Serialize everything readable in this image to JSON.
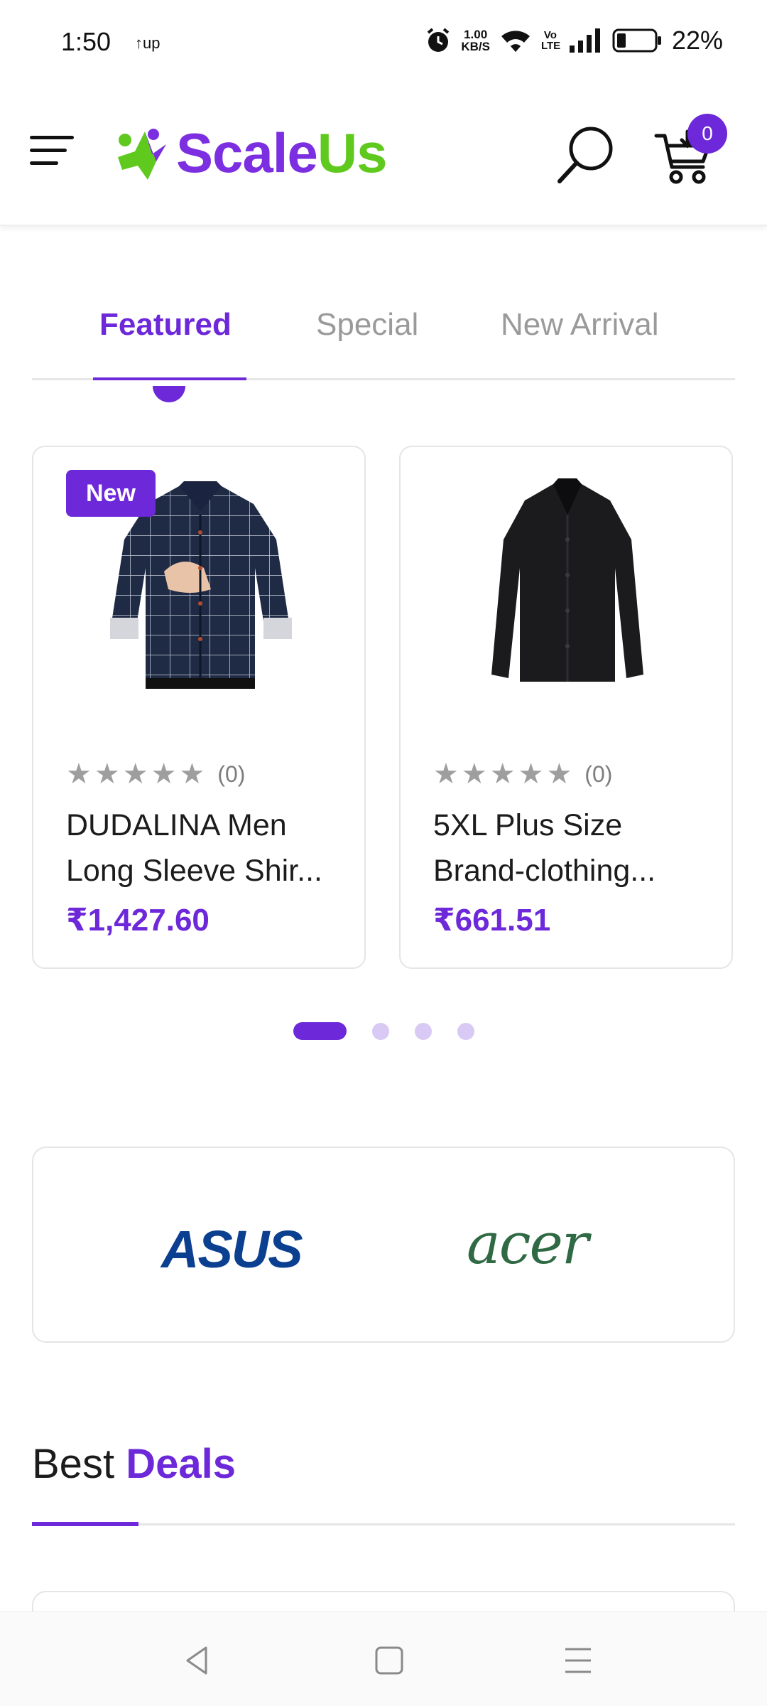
{
  "status_bar": {
    "time": "1:50",
    "up_indicator": "↑up",
    "speed_value": "1.00",
    "speed_unit": "KB/S",
    "volte": "Vo LTE",
    "battery": "22%",
    "icons": [
      "alarm-icon",
      "wifi-icon",
      "signal-icon",
      "battery-icon"
    ]
  },
  "header": {
    "logo_part1": "Scale",
    "logo_part2": "Us",
    "cart_count": "0",
    "icons": [
      "menu-icon",
      "search-icon",
      "cart-icon"
    ]
  },
  "tabs": [
    {
      "label": "Featured",
      "active": true
    },
    {
      "label": "Special",
      "active": false
    },
    {
      "label": "New Arrival",
      "active": false
    }
  ],
  "products": [
    {
      "badge": "New",
      "rating_count": "(0)",
      "title_line1": "DUDALINA Men",
      "title_line2": "Long Sleeve Shir...",
      "price": "₹1,427.60"
    },
    {
      "badge": "",
      "rating_count": "(0)",
      "title_line1": "5XL Plus Size",
      "title_line2": "Brand-clothing...",
      "price": "₹661.51"
    }
  ],
  "carousel": {
    "pages": 4,
    "active_index": 0
  },
  "brands": [
    {
      "name": "ASUS"
    },
    {
      "name": "acer"
    }
  ],
  "best_deals": {
    "word1": "Best",
    "word2": "Deals"
  },
  "colors": {
    "accent": "#6d28d9",
    "logo_green": "#5fc91e",
    "star_gray": "#9e9e9e",
    "asus_blue": "#0b3f8f",
    "acer_green": "#2f6a44"
  },
  "nav_icons": [
    "back-icon",
    "home-icon",
    "recents-icon"
  ]
}
